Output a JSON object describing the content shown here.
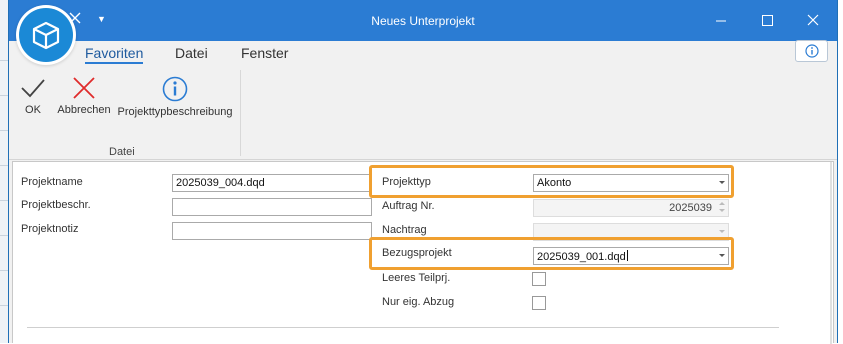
{
  "window": {
    "title": "Neues Unterprojekt"
  },
  "ribbon": {
    "tabs": [
      "Favoriten",
      "Datei",
      "Fenster"
    ],
    "buttons": {
      "ok": "OK",
      "cancel": "Abbrechen",
      "description": "Projekttypbeschreibung"
    },
    "group_label": "Datei"
  },
  "form": {
    "projektname": {
      "label": "Projektname",
      "value": "2025039_004.dqd"
    },
    "projektbeschr": {
      "label": "Projektbeschr.",
      "value": ""
    },
    "projektnotiz": {
      "label": "Projektnotiz",
      "value": ""
    },
    "projekttyp": {
      "label": "Projekttyp",
      "value": "Akonto"
    },
    "auftrag_nr": {
      "label": "Auftrag Nr.",
      "value": "2025039"
    },
    "nachtrag": {
      "label": "Nachtrag",
      "value": ""
    },
    "bezugsprojekt": {
      "label": "Bezugsprojekt",
      "value": "2025039_001.dqd"
    },
    "leeres_teilprj": {
      "label": "Leeres Teilprj.",
      "checked": false
    },
    "nur_eig_abzug": {
      "label": "Nur eig. Abzug",
      "checked": false
    }
  },
  "colors": {
    "titlebar": "#2b7cd3",
    "highlight": "#f0a030",
    "logo": "#1b89d6"
  },
  "icons": [
    "app-logo-icon",
    "close-x-icon",
    "dropdown-arrow-icon",
    "minimize-icon",
    "maximize-icon",
    "window-close-icon",
    "info-icon",
    "checkmark-icon",
    "cancel-x-icon"
  ]
}
